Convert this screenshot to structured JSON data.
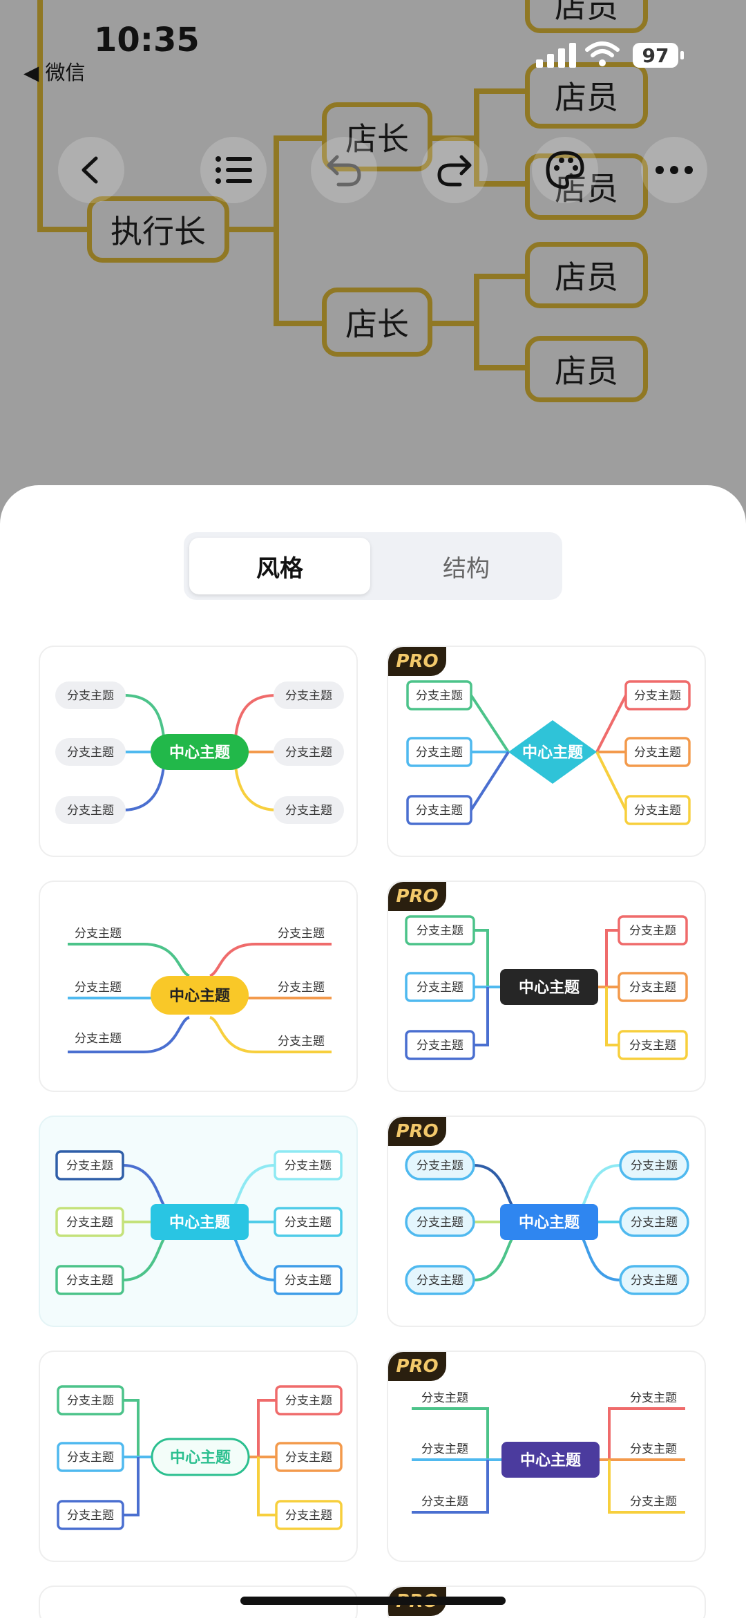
{
  "status_bar": {
    "time": "10:35",
    "back_app": "◀ 微信",
    "battery": "97"
  },
  "background_chart": {
    "root": "执行长",
    "managers": [
      "店长",
      "店长"
    ],
    "staff": [
      "店员",
      "店员",
      "店员",
      "店员",
      "店员"
    ]
  },
  "toolbar": {
    "back_icon": "chevron-left-icon",
    "outline_icon": "list-icon",
    "undo_icon": "undo-icon",
    "redo_icon": "redo-icon",
    "theme_icon": "palette-icon",
    "more_icon": "more-icon"
  },
  "sheet": {
    "tabs": [
      {
        "label": "风格",
        "active": true
      },
      {
        "label": "结构",
        "active": false
      }
    ],
    "pro_badge": "PRO",
    "center_label": "中心主题",
    "branch_label": "分支主题"
  },
  "colors": {
    "node_border": "#e8c23a",
    "pro_bg": "#2a1f0f",
    "pro_text": "#f3c96b",
    "green": "#4cc38a",
    "blue": "#4a6fd0",
    "red": "#ef6b6b",
    "orange": "#f39a4c",
    "yellow": "#f7cf3d",
    "sky": "#4fb9ef"
  }
}
